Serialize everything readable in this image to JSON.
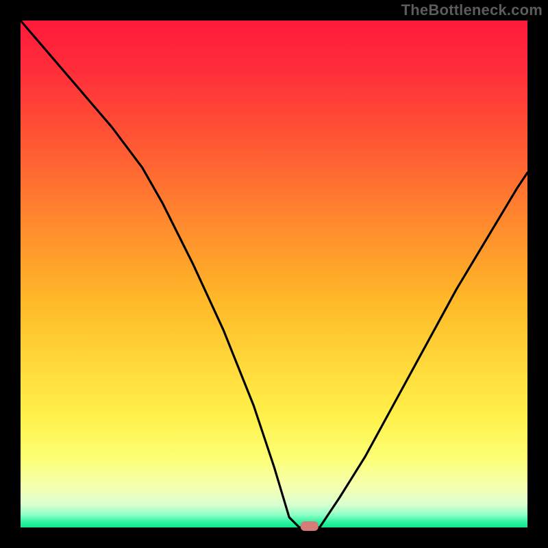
{
  "watermark": "TheBottleneck.com",
  "colors": {
    "frame": "#000000",
    "curve": "#000000",
    "marker_fill": "#d57b78",
    "gradient_stops": [
      {
        "offset": 0.0,
        "color": "#ff1a3a"
      },
      {
        "offset": 0.1,
        "color": "#ff2e3a"
      },
      {
        "offset": 0.25,
        "color": "#ff5a33"
      },
      {
        "offset": 0.4,
        "color": "#ff8a2e"
      },
      {
        "offset": 0.55,
        "color": "#ffb828"
      },
      {
        "offset": 0.68,
        "color": "#ffd93a"
      },
      {
        "offset": 0.78,
        "color": "#fff04a"
      },
      {
        "offset": 0.86,
        "color": "#fcff72"
      },
      {
        "offset": 0.92,
        "color": "#f5ffb0"
      },
      {
        "offset": 0.955,
        "color": "#d9ffd0"
      },
      {
        "offset": 0.975,
        "color": "#8dffc6"
      },
      {
        "offset": 0.99,
        "color": "#2bf39f"
      },
      {
        "offset": 1.0,
        "color": "#12e48f"
      }
    ]
  },
  "chart_data": {
    "type": "line",
    "title": "",
    "xlabel": "",
    "ylabel": "",
    "xlim": [
      0,
      100
    ],
    "ylim": [
      0,
      100
    ],
    "grid": false,
    "legend": false,
    "note": "V-shaped bottleneck curve; y≈mismatch %, x≈relative component performance. Minimum ~0% at x≈57; flat near-zero region x≈53–59.",
    "x": [
      0,
      6,
      12,
      18,
      24,
      28,
      34,
      40,
      46,
      50,
      53,
      55,
      57,
      59,
      63,
      68,
      74,
      80,
      86,
      92,
      98,
      100
    ],
    "values": [
      100,
      93,
      86,
      79,
      71,
      64,
      52,
      39,
      24,
      12,
      2,
      0,
      0,
      0,
      6,
      14,
      25,
      36,
      47,
      57,
      67,
      70
    ],
    "marker": {
      "x": 57,
      "y": 0,
      "label": ""
    }
  }
}
